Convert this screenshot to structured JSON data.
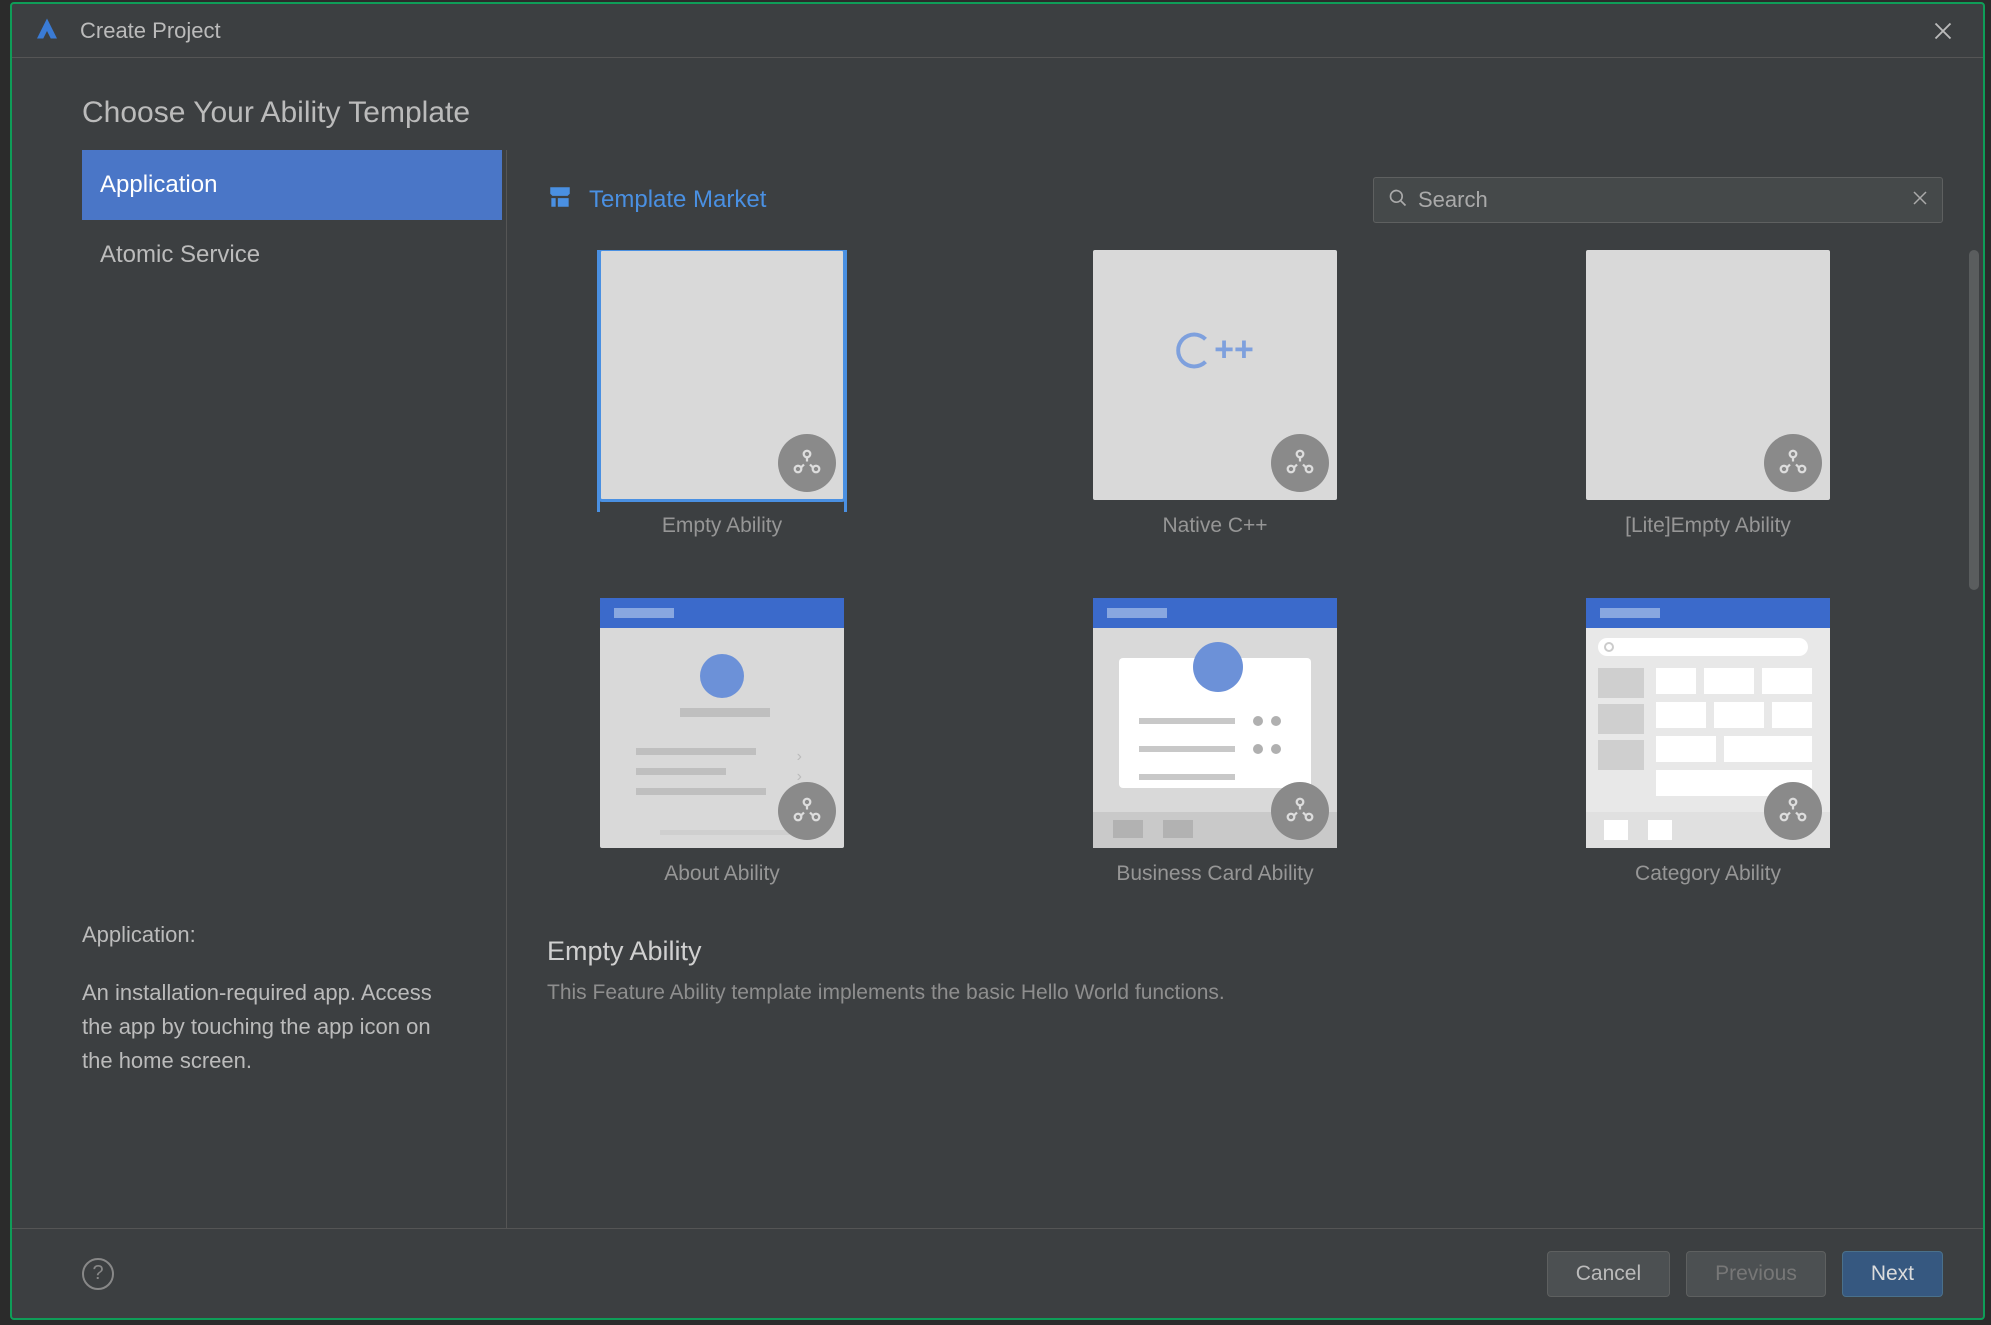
{
  "window": {
    "title": "Create Project"
  },
  "heading": "Choose Your Ability Template",
  "sidebar": {
    "items": [
      {
        "label": "Application",
        "selected": true
      },
      {
        "label": "Atomic Service",
        "selected": false
      }
    ],
    "desc": {
      "title": "Application:",
      "body": "An installation-required app. Access the app by touching the app icon on the home screen."
    }
  },
  "content": {
    "market_label": "Template Market",
    "search": {
      "placeholder": "Search",
      "value": ""
    },
    "templates": [
      {
        "label": "Empty Ability",
        "kind": "blank",
        "selected": true
      },
      {
        "label": "Native C++",
        "kind": "cpp",
        "selected": false
      },
      {
        "label": "[Lite]Empty Ability",
        "kind": "blank",
        "selected": false
      },
      {
        "label": "About Ability",
        "kind": "about",
        "selected": false
      },
      {
        "label": "Business Card Ability",
        "kind": "bizcard",
        "selected": false
      },
      {
        "label": "Category Ability",
        "kind": "category",
        "selected": false
      }
    ],
    "detail": {
      "title": "Empty Ability",
      "desc": "This Feature Ability template implements the basic Hello World functions."
    }
  },
  "footer": {
    "cancel": "Cancel",
    "previous": "Previous",
    "next": "Next"
  }
}
